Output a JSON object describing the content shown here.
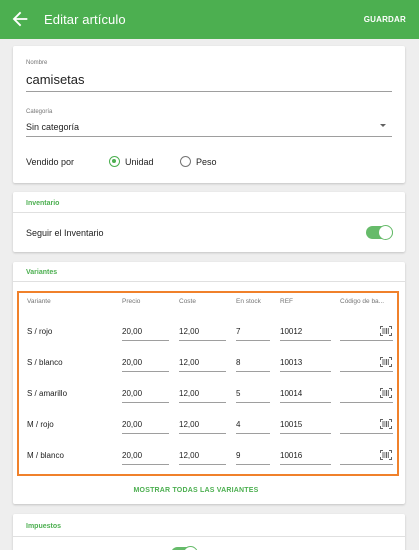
{
  "appbar": {
    "title": "Editar artículo",
    "save_label": "GUARDAR"
  },
  "item": {
    "name_label": "Nombre",
    "name_value": "camisetas",
    "category_label": "Categoría",
    "category_value": "Sin categoría",
    "sold_by_label": "Vendido por",
    "sold_by_options": [
      "Unidad",
      "Peso"
    ],
    "sold_by_selected": "Unidad"
  },
  "inventory": {
    "title": "Inventario",
    "track_label": "Seguir el Inventario",
    "track_enabled": true
  },
  "variants": {
    "title": "Variantes",
    "headers": [
      "Variante",
      "Precio",
      "Coste",
      "En stock",
      "REF",
      "Código de ba..."
    ],
    "rows": [
      {
        "name": "S / rojo",
        "price": "20,00",
        "cost": "12,00",
        "stock": "7",
        "ref": "10012",
        "barcode": ""
      },
      {
        "name": "S / blanco",
        "price": "20,00",
        "cost": "12,00",
        "stock": "8",
        "ref": "10013",
        "barcode": ""
      },
      {
        "name": "S / amarillo",
        "price": "20,00",
        "cost": "12,00",
        "stock": "5",
        "ref": "10014",
        "barcode": ""
      },
      {
        "name": "M / rojo",
        "price": "20,00",
        "cost": "12,00",
        "stock": "4",
        "ref": "10015",
        "barcode": ""
      },
      {
        "name": "M / blanco",
        "price": "20,00",
        "cost": "12,00",
        "stock": "9",
        "ref": "10016",
        "barcode": ""
      }
    ],
    "show_all_label": "MOSTRAR TODAS LAS VARIANTES"
  },
  "taxes": {
    "title": "Impuestos"
  },
  "colors": {
    "primary": "#4caf50",
    "highlight": "#f0812b"
  },
  "icons": {
    "back": "arrow-left-icon",
    "barcode": "barcode-scan-icon",
    "dropdown": "caret-down-icon"
  }
}
